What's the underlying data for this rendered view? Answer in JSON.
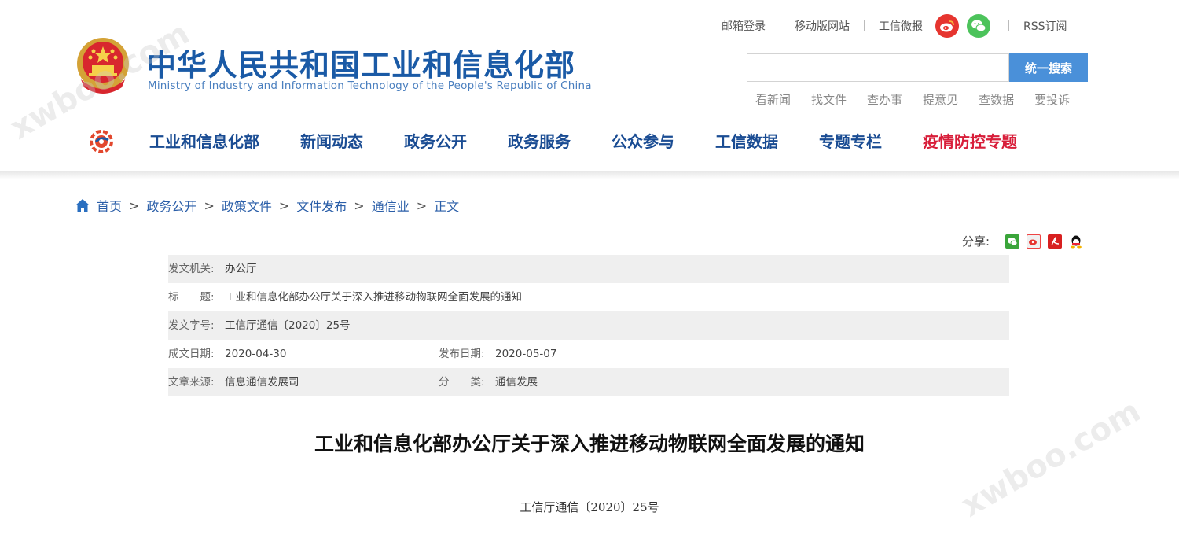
{
  "header": {
    "title_cn": "中华人民共和国工业和信息化部",
    "title_en": "Ministry of Industry and Information Technology of the People's Republic of China"
  },
  "toplinks": [
    "邮箱登录",
    "移动版网站",
    "工信微报",
    "RSS订阅"
  ],
  "social_icons": [
    "weibo-icon",
    "wechat-icon"
  ],
  "search": {
    "placeholder": "",
    "button_label": "统一搜索"
  },
  "quicklinks": [
    "看新闻",
    "找文件",
    "查办事",
    "提意见",
    "查数据",
    "要投诉"
  ],
  "nav": [
    "工业和信息化部",
    "新闻动态",
    "政务公开",
    "政务服务",
    "公众参与",
    "工信数据",
    "专题专栏",
    "疫情防控专题"
  ],
  "breadcrumb": [
    "首页",
    "政务公开",
    "政策文件",
    "文件发布",
    "通信业",
    "正文"
  ],
  "share": {
    "label": "分享:",
    "icons": [
      "wechat-share-icon",
      "weibo-share-icon",
      "pdf-icon",
      "qq-icon"
    ]
  },
  "meta": {
    "issuer_label": "发文机关:",
    "issuer": "办公厅",
    "title_label": "标　　题:",
    "title": "工业和信息化部办公厅关于深入推进移动物联网全面发展的通知",
    "docno_label": "发文字号:",
    "docno": "工信厅通信〔2020〕25号",
    "created_label": "成文日期:",
    "created": "2020-04-30",
    "published_label": "发布日期:",
    "published": "2020-05-07",
    "source_label": "文章来源:",
    "source": "信息通信发展司",
    "category_label": "分　　类:",
    "category": "通信发展"
  },
  "document": {
    "title": "工业和信息化部办公厅关于深入推进移动物联网全面发展的通知",
    "number": "工信厅通信〔2020〕25号"
  },
  "watermark": "xwboo.com",
  "colors": {
    "brand_blue": "#1a5aa6",
    "nav_red": "#d81e3a",
    "search_blue": "#4a90d9"
  }
}
